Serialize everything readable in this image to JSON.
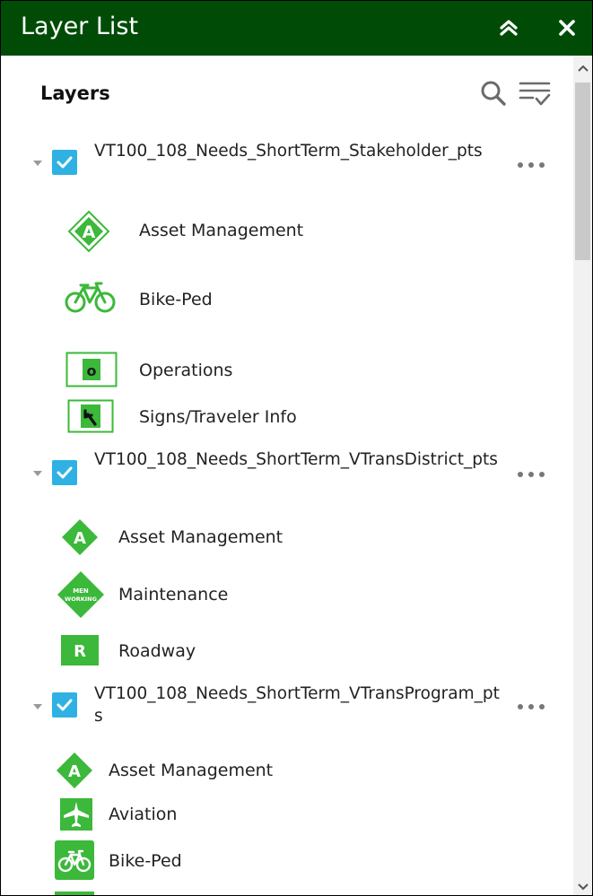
{
  "panel": {
    "title": "Layer List",
    "collapse_icon": "double-chevron-up-icon",
    "close_icon": "close-icon",
    "heading": "Layers",
    "search_icon": "search-icon",
    "filter_icon": "filter-list-icon",
    "header_color": "#004c07",
    "checkbox_color": "#2fb2e3",
    "symbol_green": "#3cb83a"
  },
  "layers": [
    {
      "name": "VT100_108_Needs_ShortTerm_Stakeholder_pts",
      "checked": true,
      "items": [
        {
          "label": "Asset Management",
          "icon": "asset-management-diamond-icon"
        },
        {
          "label": "Bike-Ped",
          "icon": "bicycle-icon"
        },
        {
          "label": "Operations",
          "icon": "operations-o-icon"
        },
        {
          "label": "Signs/Traveler Info",
          "icon": "turn-arrow-sign-icon"
        }
      ]
    },
    {
      "name": "VT100_108_Needs_ShortTerm_VTransDistrict_pts",
      "checked": true,
      "items": [
        {
          "label": "Asset Management",
          "icon": "asset-management-diamond-icon"
        },
        {
          "label": "Maintenance",
          "icon": "men-working-sign-icon"
        },
        {
          "label": "Roadway",
          "icon": "roadway-r-icon"
        }
      ]
    },
    {
      "name": "VT100_108_Needs_ShortTerm_VTransProgram_pts",
      "checked": true,
      "items": [
        {
          "label": "Asset Management",
          "icon": "asset-management-diamond-icon"
        },
        {
          "label": "Aviation",
          "icon": "airplane-icon"
        },
        {
          "label": "Bike-Ped",
          "icon": "bicycle-icon"
        }
      ]
    }
  ]
}
